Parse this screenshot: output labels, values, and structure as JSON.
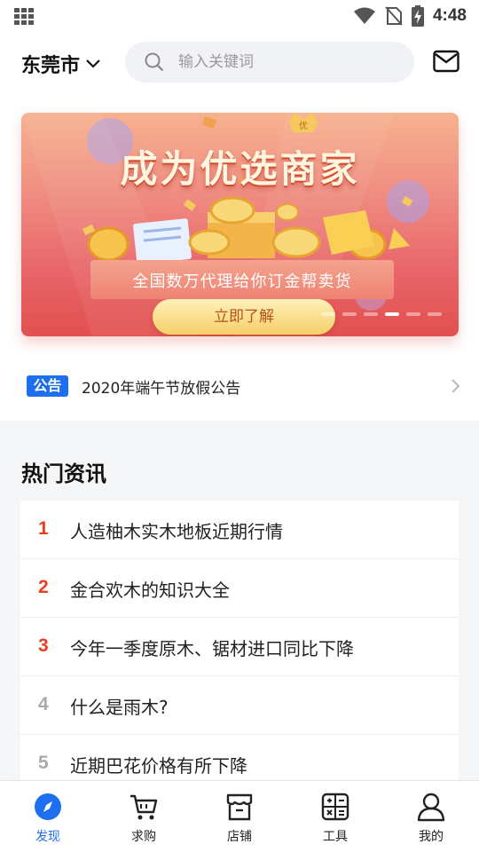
{
  "status_bar": {
    "time": "4:48",
    "icons": [
      "app-grid-icon",
      "wifi-icon",
      "no-sim-icon",
      "battery-charging-icon"
    ]
  },
  "header": {
    "city": "东莞市",
    "search_placeholder": "输入关键词",
    "icons": [
      "chevron-down-icon",
      "search-icon",
      "mail-icon"
    ]
  },
  "banner": {
    "headline": "成为优选商家",
    "badge": "优",
    "subtitle": "全国数万代理给你订金帮卖货",
    "button_label": "立即了解",
    "slide_count": 6,
    "active_slide": 4,
    "colors": {
      "top": "#f7b28f",
      "bottom": "#e2504f",
      "button": "#f6cf6a"
    }
  },
  "notice": {
    "badge": "公告",
    "text": "2020年端午节放假公告"
  },
  "hot_news": {
    "title": "热门资讯",
    "items": [
      {
        "rank": "1",
        "title": "人造柚木实木地板近期行情",
        "hot": true
      },
      {
        "rank": "2",
        "title": "金合欢木的知识大全",
        "hot": true
      },
      {
        "rank": "3",
        "title": "今年一季度原木、锯材进口同比下降",
        "hot": true
      },
      {
        "rank": "4",
        "title": "什么是雨木?",
        "hot": false
      },
      {
        "rank": "5",
        "title": "近期巴花价格有所下降",
        "hot": false
      }
    ],
    "colors": {
      "hot_rank": "#ec3c1f",
      "normal_rank": "#aaaaaa"
    }
  },
  "bottom_nav": {
    "items": [
      {
        "label": "发现",
        "icon": "compass-icon",
        "active": true
      },
      {
        "label": "求购",
        "icon": "cart-icon",
        "active": false
      },
      {
        "label": "店铺",
        "icon": "store-icon",
        "active": false
      },
      {
        "label": "工具",
        "icon": "calculator-icon",
        "active": false
      },
      {
        "label": "我的",
        "icon": "user-icon",
        "active": false
      }
    ],
    "colors": {
      "active": "#1e6ff0",
      "inactive": "#222222"
    }
  }
}
